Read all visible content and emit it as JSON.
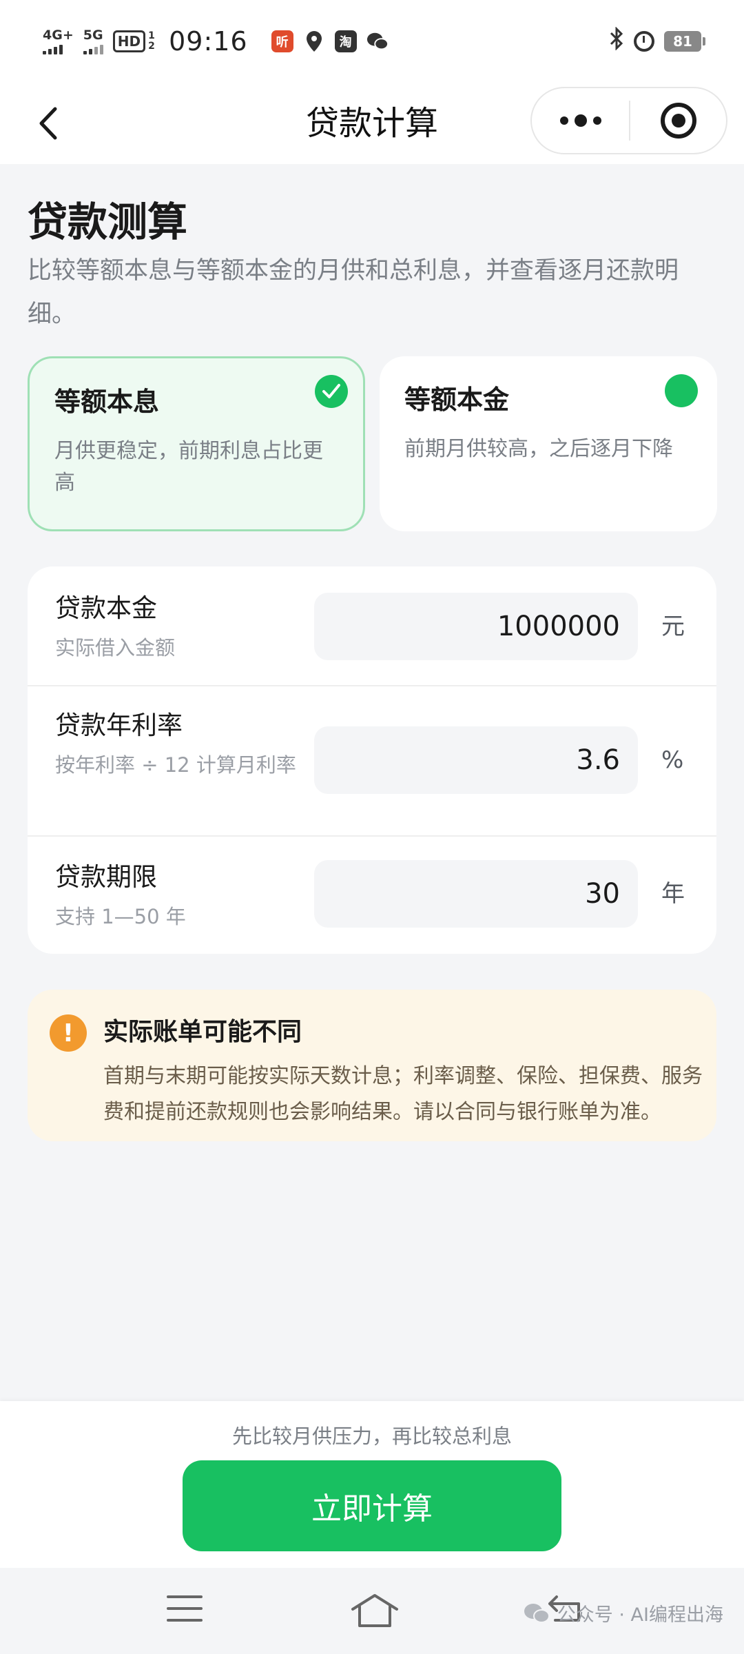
{
  "status_bar": {
    "net1": "4G+",
    "net2": "5G",
    "hd": "HD",
    "hd_sub": "1\n2",
    "time": "09:16",
    "app_ting": "听",
    "app_tao": "淘",
    "battery": "81"
  },
  "nav": {
    "title": "贷款计算"
  },
  "header": {
    "title": "贷款测算",
    "subtitle": "比较等额本息与等额本金的月供和总利息，并查看逐月还款明细。"
  },
  "methods": [
    {
      "title": "等额本息",
      "desc": "月供更稳定，前期利息占比更高",
      "selected": true
    },
    {
      "title": "等额本金",
      "desc": "前期月供较高，之后逐月下降",
      "selected": false
    }
  ],
  "form": {
    "principal": {
      "label": "贷款本金",
      "hint": "实际借入金额",
      "value": "1000000",
      "unit": "元"
    },
    "rate": {
      "label": "贷款年利率",
      "hint": "按年利率 ÷ 12 计算月利率",
      "value": "3.6",
      "unit": "%"
    },
    "term": {
      "label": "贷款期限",
      "hint": "支持 1—50 年",
      "value": "30",
      "unit": "年"
    }
  },
  "notice": {
    "icon": "!",
    "title": "实际账单可能不同",
    "body": "首期与末期可能按实际天数计息；利率调整、保险、担保费、服务费和提前还款规则也会影响结果。请以合同与银行账单为准。"
  },
  "bottom": {
    "hint": "先比较月供压力，再比较总利息",
    "button": "立即计算"
  },
  "watermark": "公众号 · AI编程出海",
  "colors": {
    "primary": "#18c061",
    "selected_bg": "#eefaf2",
    "selected_border": "#9fe0b5",
    "notice_bg": "#fdf6e7",
    "notice_icon": "#f29a2e",
    "page_bg": "#f4f5f7"
  },
  "icons": {
    "back": "chevron-left-icon",
    "more": "more-dots-icon",
    "close": "target-circle-icon",
    "selected": "check-icon",
    "notice": "exclamation-icon"
  }
}
